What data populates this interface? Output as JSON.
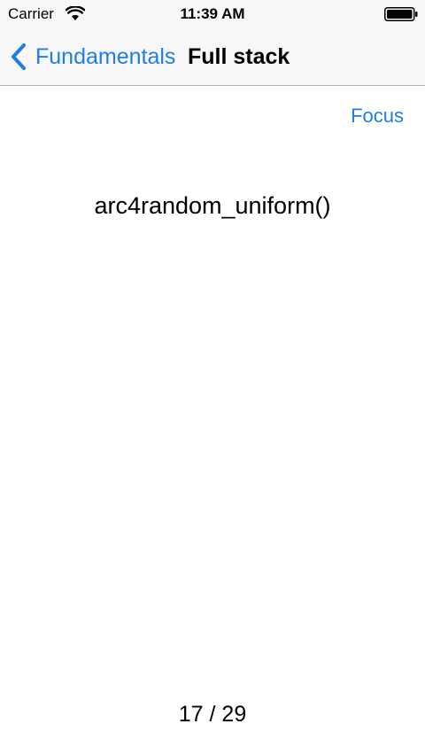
{
  "status_bar": {
    "carrier": "Carrier",
    "time": "11:39 AM",
    "icons": [
      "wifi-icon",
      "battery-icon"
    ]
  },
  "nav": {
    "back_label": "Fundamentals",
    "title": "Full stack"
  },
  "toolbar": {
    "focus_label": "Focus"
  },
  "card": {
    "term": "arc4random_uniform()"
  },
  "pagination": {
    "text": "17 / 29",
    "current": 17,
    "total": 29
  },
  "colors": {
    "accent": "#1e7ee6",
    "bar_background": "#f7f7f7",
    "separator": "#b2b2b2",
    "text": "#000000",
    "background": "#ffffff"
  }
}
